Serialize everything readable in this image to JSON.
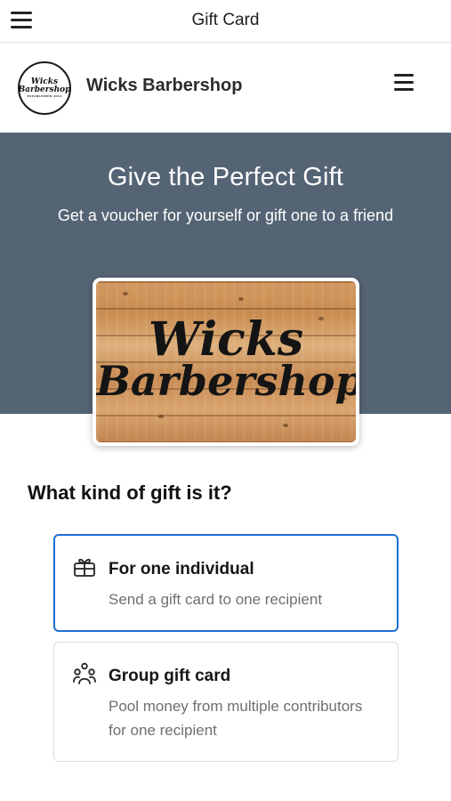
{
  "topbar": {
    "title": "Gift Card",
    "menu_icon": "hamburger-menu-icon"
  },
  "brand": {
    "name": "Wicks Barbershop",
    "logo_line1": "Wicks",
    "logo_line2": "Barbershop",
    "logo_sub": "ESTABLISHED 2012",
    "menu_icon": "hamburger-menu-icon"
  },
  "hero": {
    "title": "Give the Perfect Gift",
    "subtitle": "Get a voucher for yourself or gift one to a friend",
    "background_color": "#556475"
  },
  "card": {
    "line1": "Wicks",
    "line2": "Barbershop"
  },
  "question": "What kind of gift is it?",
  "options": [
    {
      "icon": "gift-icon",
      "title": "For one individual",
      "description": "Send a gift card to one recipient",
      "selected": true
    },
    {
      "icon": "group-icon",
      "title": "Group gift card",
      "description": "Pool money from multiple contributors for one recipient",
      "selected": false
    }
  ],
  "colors": {
    "selected_border": "#1f6fd6",
    "muted_text": "#6f6f6f"
  }
}
